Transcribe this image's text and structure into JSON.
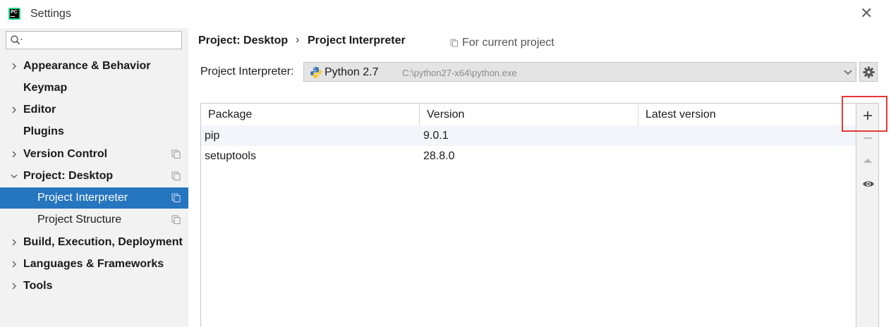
{
  "window": {
    "title": "Settings",
    "logo_text": "PC"
  },
  "sidebar": {
    "search_placeholder": "",
    "items": [
      {
        "label": "Appearance & Behavior"
      },
      {
        "label": "Keymap"
      },
      {
        "label": "Editor"
      },
      {
        "label": "Plugins"
      },
      {
        "label": "Version Control"
      },
      {
        "label": "Project: Desktop"
      },
      {
        "label": "Project Interpreter"
      },
      {
        "label": "Project Structure"
      },
      {
        "label": "Build, Execution, Deployment"
      },
      {
        "label": "Languages & Frameworks"
      },
      {
        "label": "Tools"
      }
    ]
  },
  "breadcrumb": {
    "parent": "Project: Desktop",
    "separator": "›",
    "current": "Project Interpreter",
    "scope": "For current project"
  },
  "interpreter": {
    "label": "Project Interpreter:",
    "name": "Python 2.7",
    "path": "C:\\python27-x64\\python.exe"
  },
  "packages": {
    "columns": [
      "Package",
      "Version",
      "Latest version"
    ],
    "rows": [
      {
        "package": "pip",
        "version": "9.0.1",
        "latest": ""
      },
      {
        "package": "setuptools",
        "version": "28.8.0",
        "latest": ""
      }
    ]
  },
  "toolbar": {
    "buttons": [
      "plus-icon",
      "minus-icon",
      "up-triangle-icon",
      "eye-icon"
    ]
  },
  "colors": {
    "selection": "#2675bf",
    "highlight_box": "#e53935"
  }
}
